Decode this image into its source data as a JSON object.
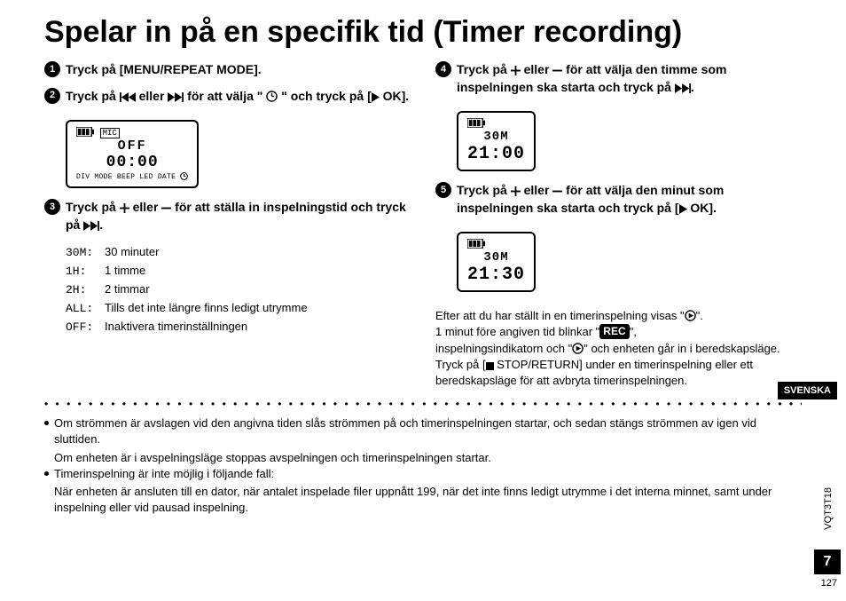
{
  "title": "Spelar in på en specifik tid (Timer recording)",
  "steps": {
    "s1": "Tryck på [MENU/REPEAT MODE].",
    "s2a": "Tryck på ",
    "s2b": " eller ",
    "s2c": " för att välja \" ",
    "s2d": " \" och tryck på [",
    "s2e": " OK].",
    "s3a": "Tryck på ",
    "s3b": " eller ",
    "s3c": " för att ställa in inspelningstid och tryck på ",
    "s3d": ".",
    "s4a": "Tryck på ",
    "s4b": " eller ",
    "s4c": " för att välja den timme som inspelningen ska starta och tryck på ",
    "s4d": ".",
    "s5a": "Tryck på ",
    "s5b": " eller ",
    "s5c": " för att välja den minut som inspelningen ska starta och tryck på [",
    "s5d": " OK]."
  },
  "defs": {
    "k30": "30M:",
    "v30": "30 minuter",
    "k1": "1H:",
    "v1": "1 timme",
    "k2": "2H:",
    "v2": "2 timmar",
    "kall": "ALL:",
    "vall": "Tills det inte längre finns ledigt utrymme",
    "koff": "OFF:",
    "voff": "Inaktivera timerinställningen"
  },
  "lcd": {
    "l1_top": "MIC",
    "l1_mid": "OFF",
    "l1_time": "00:00",
    "l1_bot": "DIV MODE BEEP LED DATE",
    "l2_a": "30M",
    "l2_b": "21:00",
    "l3_a": "30M",
    "l3_b": "21:30"
  },
  "after": {
    "p1a": "Efter att du har ställt in en timerinspelning visas \"",
    "p1b": "\".",
    "p2a": "1 minut före angiven tid blinkar \"",
    "p2b": "\",",
    "rec": "REC",
    "p3a": "inspelningsindikatorn och \"",
    "p3b": "\" och enheten går in i beredskapsläge.",
    "p4a": "Tryck på [",
    "p4b": " STOP/RETURN] under en timerinspelning eller ett beredskapsläge för att avbryta timerinspelningen."
  },
  "notes": {
    "n1": "Om strömmen är avslagen vid den angivna tiden slås strömmen på och timerinspelningen startar, och sedan stängs strömmen av igen vid sluttiden.",
    "n1b": "Om enheten är i avspelningsläge stoppas avspelningen och timerinspelningen startar.",
    "n2": "Timerinspelning är inte möjlig i följande fall:",
    "n2b": "När enheten är ansluten till en dator, när antalet inspelade filer uppnått 199, när det inte finns ledigt utrymme i det interna minnet, samt under inspelning eller vid pausad inspelning."
  },
  "side": "SVENSKA",
  "vcode": "VQT3T18",
  "pgbig": "7",
  "pgsmall": "127"
}
